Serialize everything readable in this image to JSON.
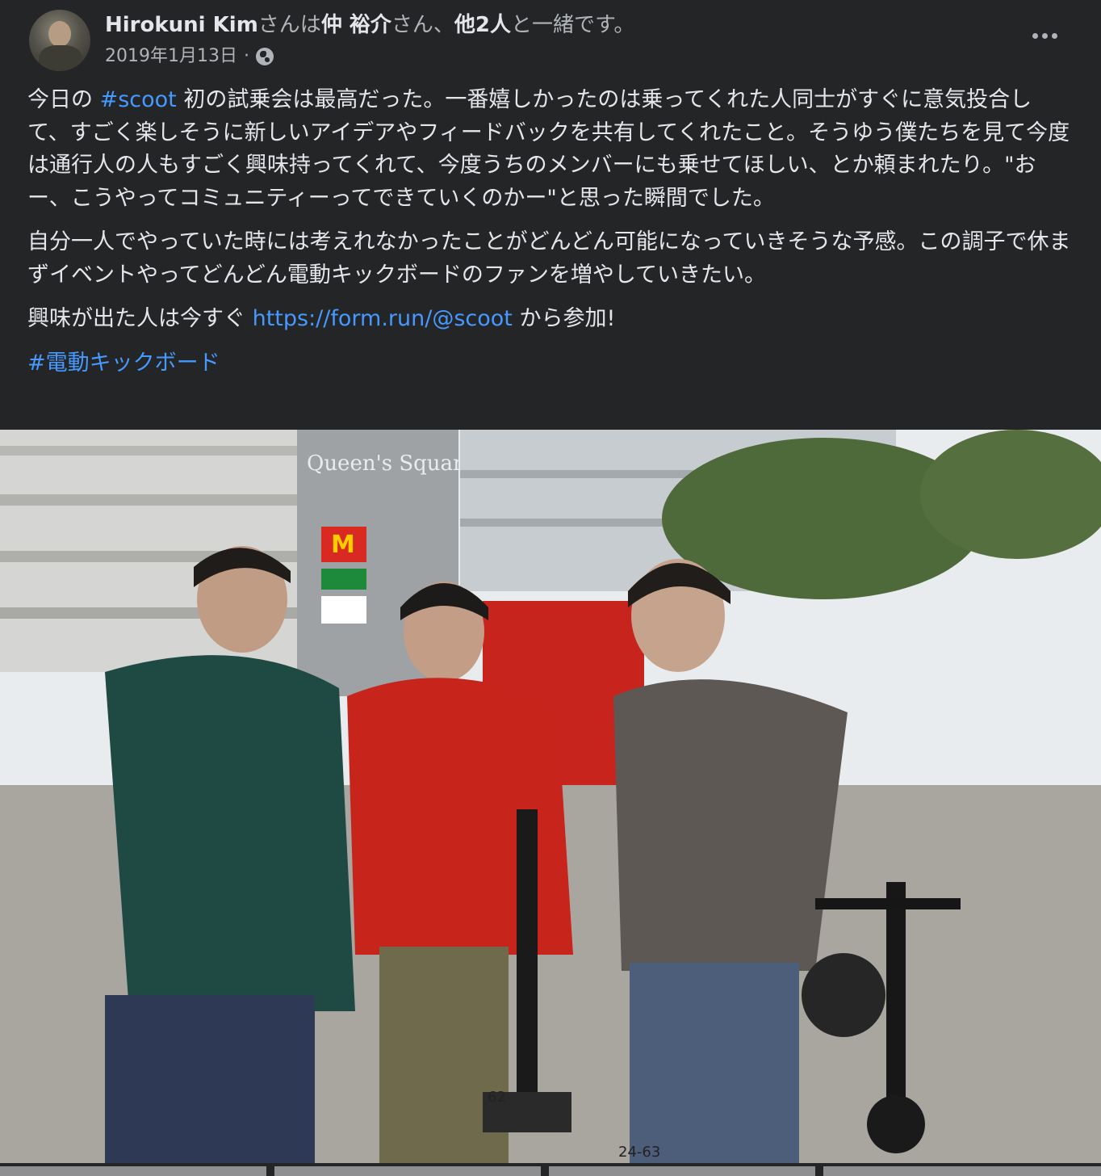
{
  "post": {
    "author": "Hirokuni Kim",
    "with_prefix": "さんは",
    "tagged_1": "仲 裕介",
    "with_mid": "さん、",
    "tagged_others": "他2人",
    "with_suffix": "と一緒です。",
    "date": "2019年1月13日",
    "separator": "·",
    "privacy_icon": "globe-icon",
    "more_icon": "more-horizontal-icon"
  },
  "body": {
    "p1_a": "今日の ",
    "p1_hashtag": "#scoot",
    "p1_b": " 初の試乗会は最高だった。一番嬉しかったのは乗ってくれた人同士がすぐに意気投合して、すごく楽しそうに新しいアイデアやフィードバックを共有してくれたこと。そうゆう僕たちを見て今度は通行人の人もすごく興味持ってくれて、今度うちのメンバーにも乗せてほしい、とか頼まれたり。\"おー、こうやってコミュニティーってできていくのかー\"と思った瞬間でした。",
    "p2": "自分一人でやっていた時には考えれなかったことがどんどん可能になっていきそうな予感。この調子で休まずイベントやってどんどん電動キックボードのファンを増やしていきたい。",
    "p3_a": "興味が出た人は今すぐ ",
    "p3_link": "https://form.run/@scoot",
    "p3_b": " から参加!",
    "hashtag": "#電動キックボード"
  },
  "photo": {
    "sign_text": "Queen's Square",
    "scooter_plate_1": "62",
    "scooter_plate_2": "24-63"
  },
  "colors": {
    "background": "#242526",
    "text_primary": "#e4e6eb",
    "text_secondary": "#b0b3b8",
    "link": "#4599ff"
  }
}
